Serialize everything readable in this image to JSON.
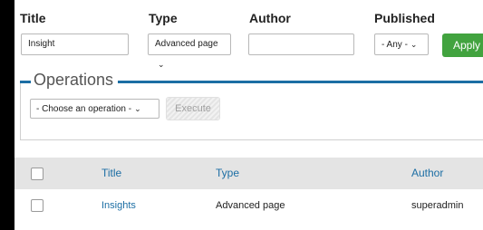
{
  "filters": {
    "title": {
      "label": "Title",
      "value": "Insight"
    },
    "type": {
      "label": "Type",
      "value": "Advanced page"
    },
    "author": {
      "label": "Author",
      "value": ""
    },
    "published": {
      "label": "Published",
      "value": "- Any -"
    },
    "apply_label": "Apply"
  },
  "operations": {
    "legend": "Operations",
    "select_value": "- Choose an operation -",
    "execute_label": "Execute"
  },
  "table": {
    "headers": {
      "title": "Title",
      "type": "Type",
      "author": "Author"
    },
    "rows": [
      {
        "title": "Insights",
        "type": "Advanced page",
        "author": "superadmin"
      }
    ]
  },
  "colors": {
    "accent": "#1c6ea4",
    "apply": "#42a33f"
  }
}
